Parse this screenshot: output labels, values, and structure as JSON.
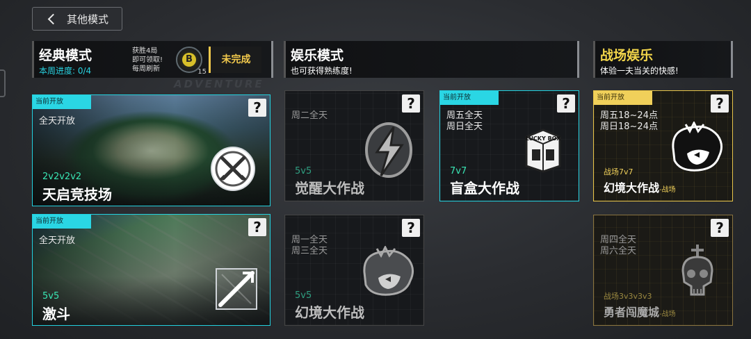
{
  "nav": {
    "back_label": "其他模式"
  },
  "watermark": "ADVENTURE",
  "classic": {
    "title": "经典模式",
    "progress": "本周进度: 0/4",
    "reward_lines": [
      "获胜4局",
      "即可领取!",
      "每周刷新"
    ],
    "coin_symbol": "B",
    "coin_count": "15",
    "status_button": "未完成",
    "cards": [
      {
        "tag": "当前开放",
        "schedule": [
          "全天开放"
        ],
        "team": "2v2v2v2",
        "name": "天启竞技场",
        "icon": "crossed-swords-icon"
      },
      {
        "tag": "当前开放",
        "schedule": [
          "全天开放"
        ],
        "team": "5v5",
        "name": "激斗",
        "icon": "expand-arrow-icon"
      }
    ]
  },
  "entertainment": {
    "title": "娱乐模式",
    "subtitle": "也可获得熟练度!",
    "cards": [
      {
        "tag": "",
        "schedule": [
          "周二全天"
        ],
        "team": "5v5",
        "name": "觉醒大作战",
        "icon": "lightning-icon",
        "active": false
      },
      {
        "tag": "当前开放",
        "schedule": [
          "周五全天",
          "周日全天"
        ],
        "team": "7v7",
        "name": "盲盒大作战",
        "icon": "lucky-box-icon",
        "active": true
      },
      {
        "tag": "",
        "schedule": [
          "周一全天",
          "周三全天"
        ],
        "team": "5v5",
        "name": "幻境大作战",
        "icon": "hero-head-icon",
        "active": false
      }
    ]
  },
  "battlefield": {
    "title": "战场娱乐",
    "subtitle": "体验一夫当关的快感!",
    "cards": [
      {
        "tag": "当前开放",
        "schedule": [
          "周五18~24点",
          "周日18~24点"
        ],
        "team": "战场7v7",
        "name": "幻境大作战",
        "suffix": "-战场",
        "icon": "hero-head-icon",
        "active": true
      },
      {
        "tag": "",
        "schedule": [
          "周四全天",
          "周六全天"
        ],
        "team": "战场3v3v3v3",
        "name": "勇者闯魔城",
        "suffix": "-战场",
        "icon": "skull-sword-icon",
        "active": false
      }
    ]
  },
  "help_symbol": "?",
  "box_text": "LUCKY BOX"
}
